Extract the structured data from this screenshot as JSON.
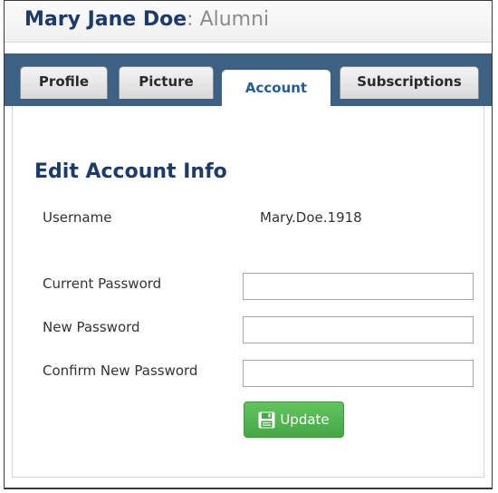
{
  "header": {
    "name": "Mary Jane Doe",
    "separator": ": ",
    "role": "Alumni"
  },
  "tabs": [
    {
      "label": "Profile",
      "active": false
    },
    {
      "label": "Picture",
      "active": false
    },
    {
      "label": "Account",
      "active": true
    },
    {
      "label": "Subscriptions",
      "active": false
    }
  ],
  "section": {
    "title": "Edit Account Info"
  },
  "account": {
    "username_label": "Username",
    "username_value": "Mary.Doe.1918",
    "current_password_label": "Current Password",
    "current_password_value": "",
    "new_password_label": "New Password",
    "new_password_value": "",
    "confirm_password_label": "Confirm New Password",
    "confirm_password_value": ""
  },
  "update_button": {
    "label": "Update",
    "icon": "save-icon"
  },
  "colors": {
    "title_navy": "#1c3b6b",
    "tabbar_blue": "#3c6182",
    "active_tab_text": "#1f5ea0",
    "button_green": "#4cb04a"
  }
}
